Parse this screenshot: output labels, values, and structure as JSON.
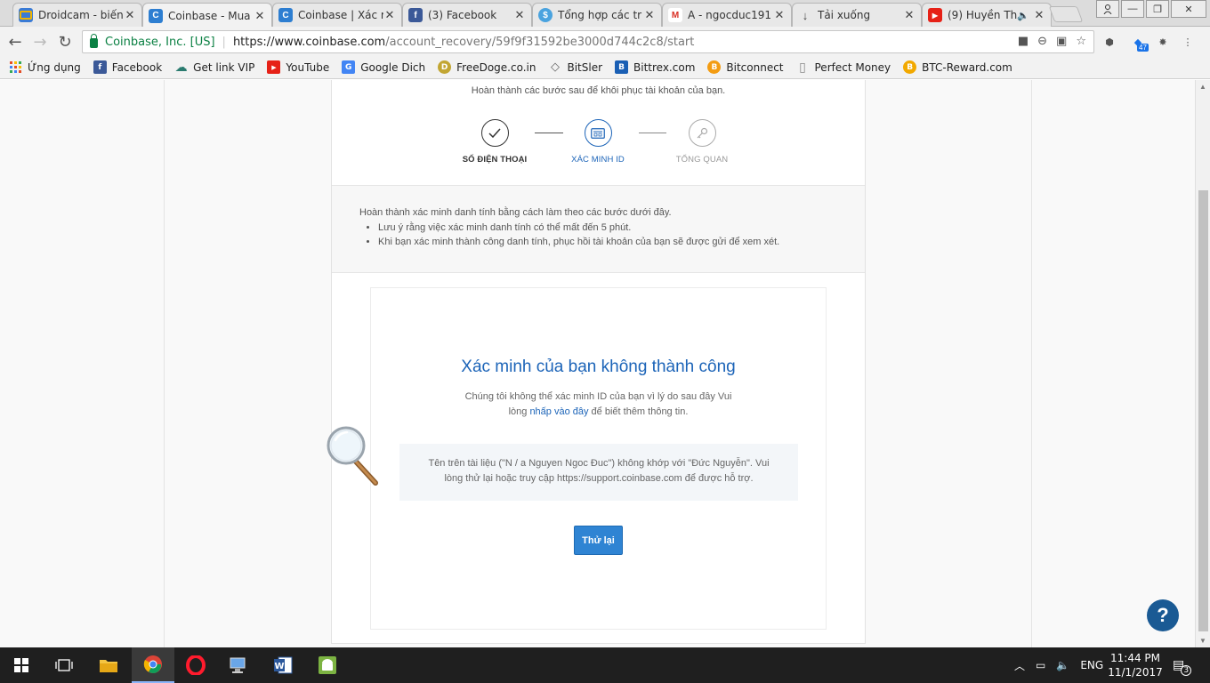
{
  "tabs": [
    {
      "title": "Droidcam - biến",
      "favicon_color": "#3a7bd5",
      "icon": "droidcam-icon"
    },
    {
      "title": "Coinbase - Mua",
      "favicon_color": "#2d7ed1",
      "icon": "coinbase-icon",
      "letter": "C"
    },
    {
      "title": "Coinbase | Xác m",
      "favicon_color": "#2d7ed1",
      "icon": "coinbase-icon",
      "letter": "C"
    },
    {
      "title": "(3) Facebook",
      "favicon_color": "#3b5998",
      "icon": "facebook-icon",
      "letter": "f"
    },
    {
      "title": "Tổng hợp các tr",
      "favicon_color": "#4aa3df",
      "icon": "site-icon",
      "letter": "$"
    },
    {
      "title": "A - ngocduc191",
      "favicon_color": "#d93025",
      "icon": "gmail-icon",
      "letter": "M"
    },
    {
      "title": "Tải xuống",
      "favicon_color": "#555555",
      "icon": "download-icon",
      "letter": "↓"
    },
    {
      "title": "(9) Huyền Th",
      "favicon_color": "#e62117",
      "icon": "youtube-icon",
      "letter": "▶"
    }
  ],
  "address": {
    "ev_name": "Coinbase, Inc. [US]",
    "url_host": "https://www.coinbase.com",
    "url_path": "/account_recovery/59f9f31592be3000d744c2c8/start"
  },
  "extension_badge": "47",
  "bookmarks": [
    {
      "label": "Ứng dụng",
      "icon": "apps-grid-icon",
      "color": "#e44d26"
    },
    {
      "label": "Facebook",
      "icon": "facebook-icon",
      "color": "#3b5998",
      "letter": "f"
    },
    {
      "label": "Get link VIP",
      "icon": "cloud-icon",
      "color": "#2a7b6f",
      "letter": "☁"
    },
    {
      "label": "YouTube",
      "icon": "youtube-icon",
      "color": "#e62117",
      "letter": "▶"
    },
    {
      "label": "Google Dich",
      "icon": "translate-icon",
      "color": "#4285f4",
      "letter": "G"
    },
    {
      "label": "FreeDoge.co.in",
      "icon": "doge-icon",
      "color": "#c2a633",
      "letter": "D"
    },
    {
      "label": "BitSler",
      "icon": "bitsler-icon",
      "color": "#666666",
      "letter": "◇"
    },
    {
      "label": "Bittrex.com",
      "icon": "bittrex-icon",
      "color": "#1a5fb4",
      "letter": "B"
    },
    {
      "label": "Bitconnect",
      "icon": "bitconnect-icon",
      "color": "#f39c12",
      "letter": "B"
    },
    {
      "label": "Perfect Money",
      "icon": "page-icon",
      "color": "#999999",
      "letter": "▯"
    },
    {
      "label": "BTC-Reward.com",
      "icon": "btc-reward-icon",
      "color": "#f2a900",
      "letter": "B"
    }
  ],
  "page": {
    "intro": "Hoàn thành các bước sau để khôi phục tài khoản của bạn.",
    "steps": [
      {
        "label": "SỐ ĐIỆN THOẠI",
        "state": "done"
      },
      {
        "label": "XÁC MINH ID",
        "state": "current"
      },
      {
        "label": "TỔNG QUAN",
        "state": "pending"
      }
    ],
    "info_heading": "Hoàn thành xác minh danh tính bằng cách làm theo các bước dưới đây.",
    "info_items": [
      "Lưu ý rằng việc xác minh danh tính có thể mất đến 5 phút.",
      "Khi bạn xác minh thành công danh tính, phục hồi tài khoản của bạn sẽ được gửi để xem xét."
    ],
    "fail_title": "Xác minh của bạn không thành công",
    "fail_desc_1": "Chúng tôi không thể xác minh ID của bạn vì lý do sau đây Vui",
    "fail_desc_2_pre": "lòng ",
    "fail_desc_link": "nhấp vào đây",
    "fail_desc_2_post": " để biết thêm thông tin.",
    "reason_line_1": "Tên trên tài liệu (\"N / a Nguyen Ngoc Đuc\") không khớp với \"Đức Nguyễn\". Vui",
    "reason_line_2": "lòng thử lại hoặc truy cập https://support.coinbase.com để được hỗ trợ.",
    "retry_label": "Thử lại",
    "help_label": "?"
  },
  "taskbar": {
    "language": "ENG",
    "time": "11:44 PM",
    "date": "11/1/2017",
    "notification_count": "3"
  },
  "colors": {
    "accent": "#1c64b8",
    "button": "#2f84d3",
    "success_step": "#333333",
    "pending_step": "#999999"
  }
}
